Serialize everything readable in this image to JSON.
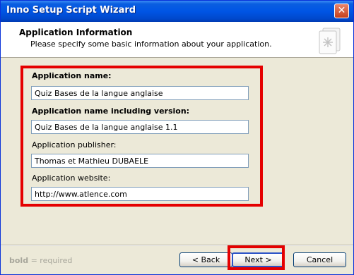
{
  "window": {
    "title": "Inno Setup Script Wizard",
    "close_glyph": "✕"
  },
  "header": {
    "title": "Application Information",
    "subtitle": "Please specify some basic information about your application."
  },
  "fields": {
    "app_name": {
      "label": "Application name:",
      "value": "Quiz Bases de la langue anglaise"
    },
    "app_name_version": {
      "label": "Application name including version:",
      "value": "Quiz Bases de la langue anglaise 1.1"
    },
    "app_publisher": {
      "label": "Application publisher:",
      "value": "Thomas et Mathieu DUBAELE"
    },
    "app_website": {
      "label": "Application website:",
      "value": "http://www.atlence.com"
    }
  },
  "footer": {
    "hint_bold": "bold",
    "hint_rest": " = required",
    "back_label": "< Back",
    "next_label": "Next >",
    "cancel_label": "Cancel"
  },
  "colors": {
    "highlight": "#e50000",
    "titlebar": "#0055e5"
  }
}
